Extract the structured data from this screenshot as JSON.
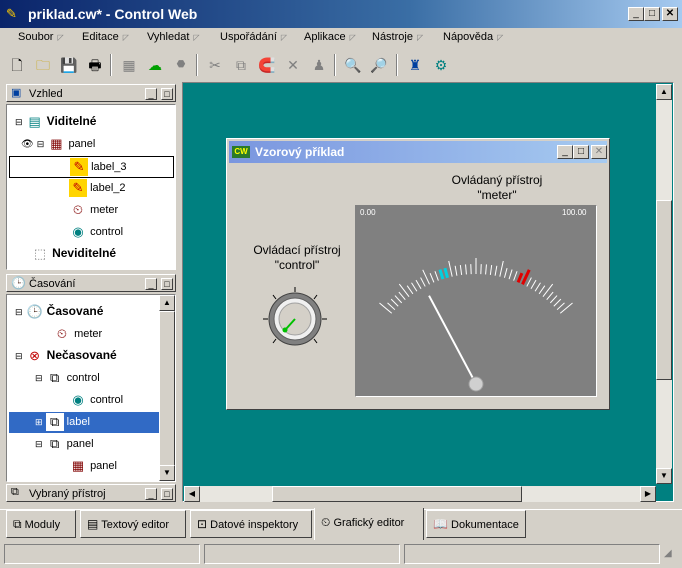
{
  "window": {
    "title": "priklad.cw* - Control Web"
  },
  "menu": [
    {
      "label": "Soubor"
    },
    {
      "label": "Editace"
    },
    {
      "label": "Vyhledat"
    },
    {
      "label": "Uspořádání"
    },
    {
      "label": "Aplikace"
    },
    {
      "label": "Nástroje"
    },
    {
      "label": "Nápověda"
    }
  ],
  "view_panel": {
    "title": "Vzhled",
    "visible_label": "Viditelné",
    "panel_label": "panel",
    "children": [
      "label_3",
      "label_2",
      "meter",
      "control"
    ],
    "invisible_label": "Neviditelné"
  },
  "timing_panel": {
    "title": "Časování",
    "timed_label": "Časované",
    "timed_children": [
      "meter"
    ],
    "untimed_label": "Nečasované",
    "items": [
      {
        "label": "control",
        "level": 1
      },
      {
        "label": "control",
        "level": 2
      },
      {
        "label": "label",
        "level": 1,
        "selected": true
      },
      {
        "label": "panel",
        "level": 1
      },
      {
        "label": "panel",
        "level": 2
      }
    ]
  },
  "selected_panel": {
    "title": "Vybraný přístroj"
  },
  "canvas": {
    "bg_color": "#008080",
    "window_title": "Vzorový příklad",
    "window_icon": "CW",
    "meter_caption_1": "Ovládaný přístroj",
    "meter_caption_2": "\"meter\"",
    "meter_min": "0.00",
    "meter_max": "100.00",
    "needle_value": 22,
    "control_caption_1": "Ovládací přístroj",
    "control_caption_2": "\"control\""
  },
  "tabs": [
    {
      "label": "Moduly"
    },
    {
      "label": "Textový editor"
    },
    {
      "label": "Datové inspektory"
    },
    {
      "label": "Grafický editor",
      "active": true
    },
    {
      "label": "Dokumentace"
    }
  ]
}
